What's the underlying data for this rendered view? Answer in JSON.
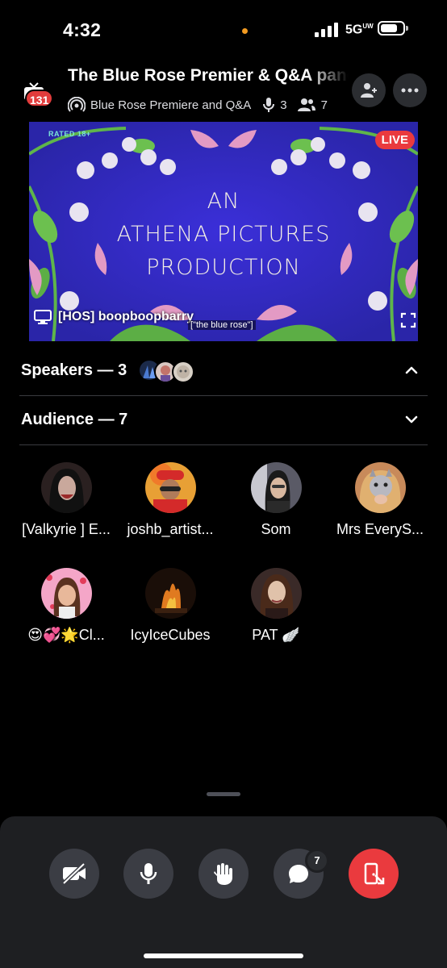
{
  "status_bar": {
    "time": "4:32",
    "network": "5G",
    "network_sup": "UW",
    "battery_level": 0.75
  },
  "header": {
    "title": "The Blue Rose Premier & Q&A panel",
    "notification_count": "131",
    "stage_name": "Blue Rose Premiere and Q&A",
    "speakers_count": "3",
    "listeners_count": "7"
  },
  "stream": {
    "rated": "RATED 18+",
    "production_lines": [
      "AN",
      "ATHENA PICTURES",
      "PRODUCTION"
    ],
    "live_label": "LIVE",
    "streamer": "[HOS] boopboopbarry",
    "caption": "[\"the blue rose\"]"
  },
  "sections": {
    "speakers_label": "Speakers — 3",
    "audience_label": "Audience — 7"
  },
  "audience": [
    {
      "name": "[Valkyrie ] E...",
      "avatar_bg": "#2a2020"
    },
    {
      "name": "joshb_artist...",
      "avatar_bg": "#e8a035"
    },
    {
      "name": "Som",
      "avatar_bg": "#4a4a58"
    },
    {
      "name": "Mrs EveryS...",
      "avatar_bg": "#c88a5a"
    },
    {
      "name": "😍💞🌟Cl...",
      "avatar_bg": "#f4a6c8"
    },
    {
      "name": "IcyIceCubes",
      "avatar_bg": "#1a0e08"
    },
    {
      "name": "PAT 🪽",
      "avatar_bg": "#3a2a28"
    }
  ],
  "controls": {
    "chat_count": "7"
  },
  "colors": {
    "accent_red": "#ea3a3e",
    "panel": "#1e1f22",
    "button": "#3b3d44"
  },
  "icons": [
    "tv-icon",
    "stage-icon",
    "mic-icon",
    "people-icon",
    "invite-icon",
    "more-icon",
    "monitor-icon",
    "fullscreen-icon",
    "chevron-up-icon",
    "chevron-down-icon",
    "video-off-icon",
    "raise-hand-icon",
    "chat-icon",
    "leave-icon"
  ]
}
